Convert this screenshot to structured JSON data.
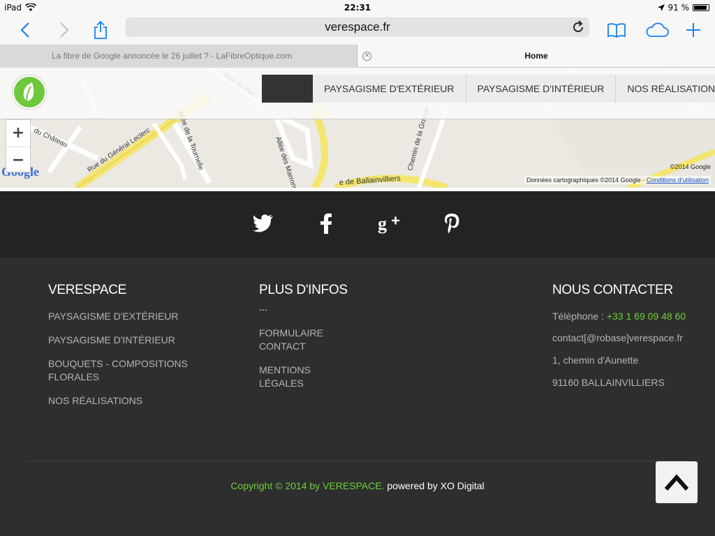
{
  "statusbar": {
    "device": "iPad",
    "time": "22:31",
    "battery": "91 %",
    "battery_level": 0.91
  },
  "browser": {
    "url": "verespace.fr",
    "tabs": [
      {
        "label": "La fibre de Google annoncée le 26 juillet ? - LaFibreOptique.com",
        "active": false
      },
      {
        "label": "Home",
        "active": true
      }
    ]
  },
  "nav": {
    "items": [
      "PAYSAGISME D'EXTÉRIEUR",
      "PAYSAGISME D'INTÉRIEUR",
      "NOS RÉALISATIONS"
    ]
  },
  "map": {
    "zoom_in": "+",
    "zoom_out": "−",
    "copyright": "©2014 Google",
    "data_credit": "Données cartographiques ©2014 Google -",
    "terms_link": "Conditions d'utilisation",
    "streets": [
      "Rue du Général Leclerc",
      "du Château",
      "Allée de la Tournelle",
      "Allée des Marronniers",
      "Rue de Ballainvilliers",
      "Chemin de la Grange",
      "Rue du Parc"
    ]
  },
  "social": {
    "icons": [
      "twitter-icon",
      "facebook-icon",
      "google-plus-icon",
      "pinterest-icon"
    ]
  },
  "footer": {
    "col1": {
      "title": "VERESPACE",
      "links": [
        "PAYSAGISME D'EXTÉRIEUR",
        "PAYSAGISME D'INTÉRIEUR",
        "BOUQUETS - COMPOSITIONS FLORALES",
        "NOS RÉALISATIONS"
      ]
    },
    "col2": {
      "title": "PLUS D'INFOS",
      "dots": "...",
      "links": [
        "FORMULAIRE CONTACT",
        "MENTIONS LÉGALES"
      ]
    },
    "col3": {
      "title": "NOUS CONTACTER",
      "phone_label": "Téléphone : ",
      "phone": "+33 1 69 09 48 60",
      "email": "contact[@robase]verespace.fr",
      "address1": "1, chemin d'Aunette",
      "address2": "91160 BALLAINVILLIERS"
    },
    "copyright": "Copyright © 2014 by VERESPACE.",
    "powered": " powered by XO Digital"
  },
  "colors": {
    "accent_green": "#6fcf3a",
    "ios_blue": "#1a7ff2",
    "footer_bg": "#2e2e2e",
    "social_bg": "#232323"
  }
}
